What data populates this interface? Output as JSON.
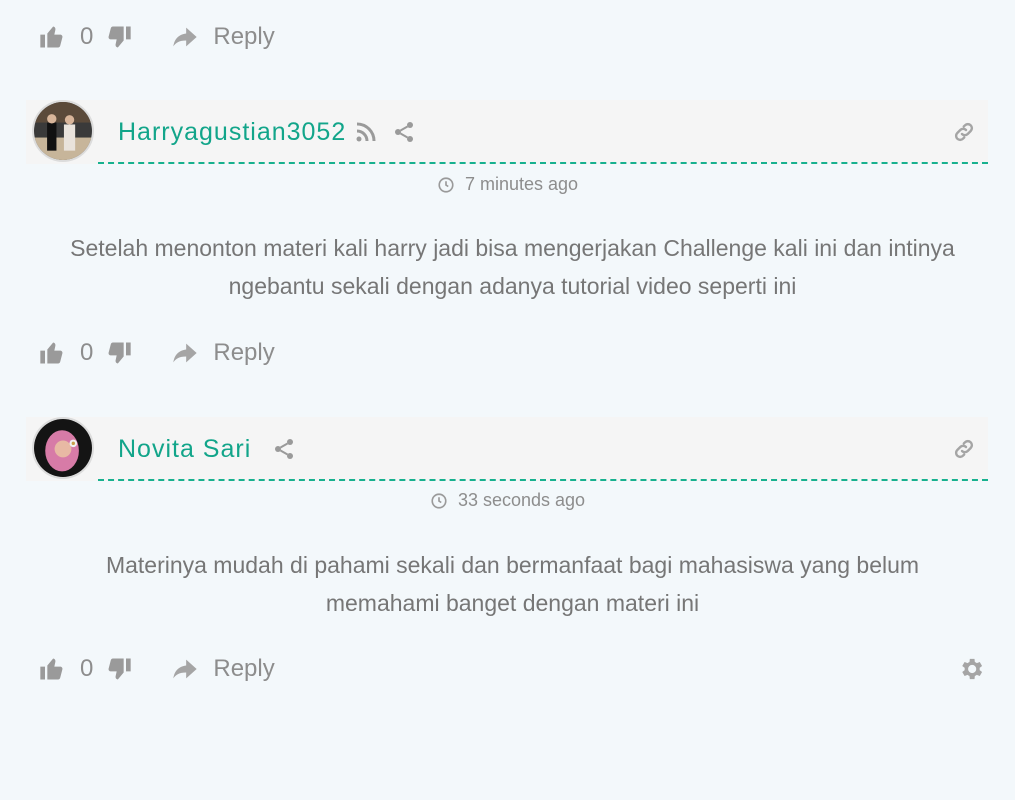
{
  "colors": {
    "accent": "#12a58a",
    "muted": "#8d8d8d",
    "text": "#767676",
    "header_bg": "#f5f5f5",
    "page_bg": "#f3f8fb"
  },
  "top_actions": {
    "upvote_icon": "thumbs-up-icon",
    "vote_count": "0",
    "downvote_icon": "thumbs-down-icon",
    "reply_icon": "reply-arrow-icon",
    "reply_label": "Reply"
  },
  "comments": [
    {
      "author": "Harryagustian3052",
      "timestamp": "7 minutes ago",
      "text": "Setelah menonton materi kali harry jadi bisa mengerjakan Challenge kali ini dan intinya ngebantu sekali dengan adanya tutorial video seperti ini",
      "vote_count": "0",
      "reply_label": "Reply",
      "header_icons": [
        "rss-icon",
        "share-icon",
        "link-icon"
      ]
    },
    {
      "author": "Novita Sari",
      "timestamp": "33 seconds ago",
      "text": "Materinya mudah di pahami sekali dan bermanfaat bagi mahasiswa yang belum memahami banget dengan materi ini",
      "vote_count": "0",
      "reply_label": "Reply",
      "header_icons": [
        "share-icon",
        "link-icon"
      ]
    }
  ],
  "footer": {
    "settings_icon": "gear-icon"
  }
}
